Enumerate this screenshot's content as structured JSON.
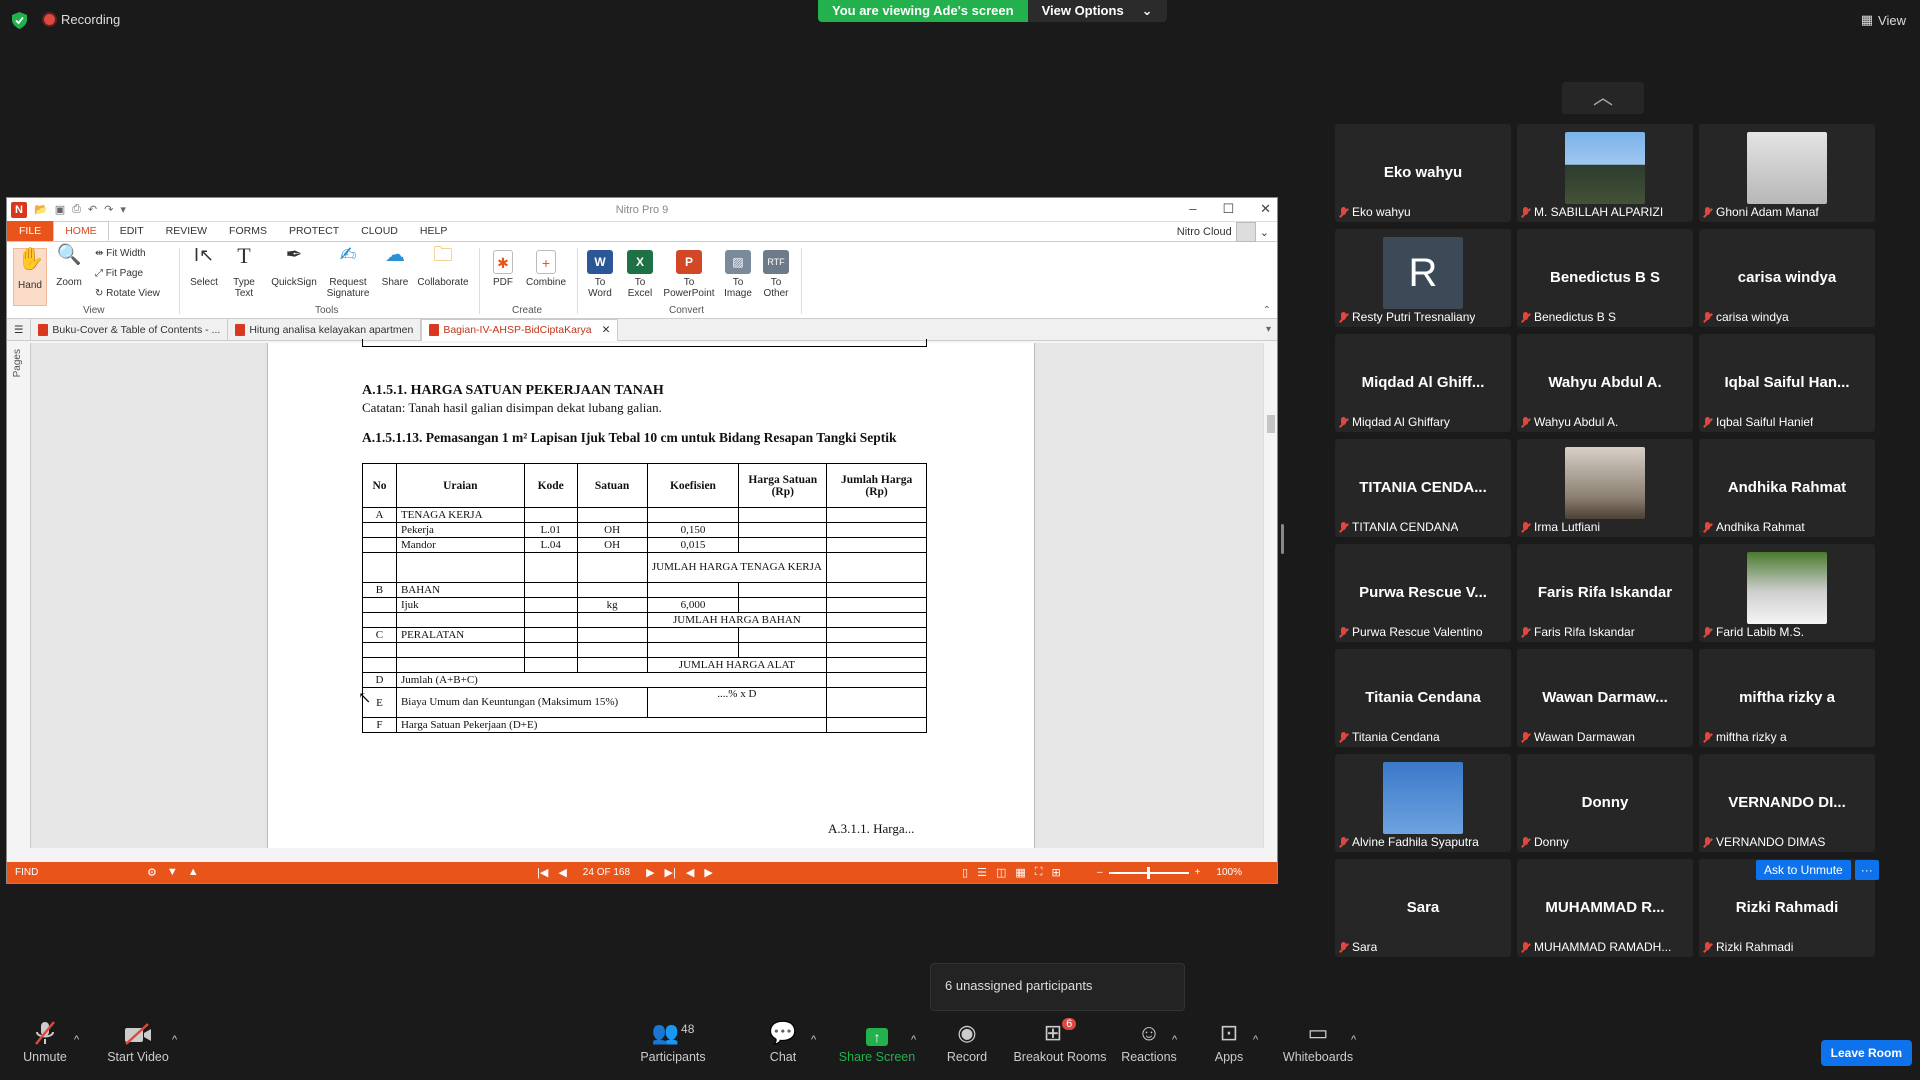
{
  "topbar": {
    "recording": "Recording",
    "viewing": "You are viewing Ade's screen",
    "view_options": "View Options",
    "view": "View"
  },
  "nitro": {
    "app_title": "Nitro Pro 9",
    "menu": {
      "file": "FILE",
      "tabs": [
        "HOME",
        "EDIT",
        "REVIEW",
        "FORMS",
        "PROTECT",
        "CLOUD",
        "HELP"
      ]
    },
    "cloud": "Nitro Cloud",
    "ribbon": {
      "hand": "Hand",
      "zoom": "Zoom",
      "fit_width": "Fit Width",
      "fit_page": "Fit Page",
      "rotate_view": "Rotate View",
      "view_group": "View",
      "select": "Select",
      "type_text_1": "Type",
      "type_text_2": "Text",
      "quicksign": "QuickSign",
      "request_sig_1": "Request",
      "request_sig_2": "Signature",
      "share": "Share",
      "collaborate": "Collaborate",
      "tools_group": "Tools",
      "pdf": "PDF",
      "combine": "Combine",
      "create_group": "Create",
      "to_word_1": "To",
      "to_word_2": "Word",
      "to_excel_1": "To",
      "to_excel_2": "Excel",
      "to_ppt_1": "To",
      "to_ppt_2": "PowerPoint",
      "to_image_1": "To",
      "to_image_2": "Image",
      "to_other_1": "To",
      "to_other_2": "Other",
      "convert_group": "Convert"
    },
    "doctabs": [
      "Buku-Cover & Table of Contents - ...",
      "Hitung analisa kelayakan apartmen",
      "Bagian-IV-AHSP-BidCiptaKarya"
    ],
    "pages_panel": "Pages",
    "doc": {
      "heading1": "A.1.5.1.  HARGA SATUAN PEKERJAAN TANAH",
      "note": "Catatan: Tanah hasil galian disimpan dekat lubang galian.",
      "heading2": "A.1.5.1.13. Pemasangan 1 m² Lapisan Ijuk Tebal 10 cm untuk Bidang Resapan Tangki Septik",
      "headers": [
        "No",
        "Uraian",
        "Kode",
        "Satuan",
        "Koefisien",
        "Harga Satuan (Rp)",
        "Jumlah Harga (Rp)"
      ],
      "rows": {
        "a_no": "A",
        "a_label": "TENAGA KERJA",
        "pekerja": "Pekerja",
        "pekerja_kode": "L.01",
        "pekerja_sat": "OH",
        "pekerja_koef": "0,150",
        "mandor": "Mandor",
        "mandor_kode": "L.04",
        "mandor_sat": "OH",
        "mandor_koef": "0,015",
        "jumlah_tk": "JUMLAH HARGA TENAGA KERJA",
        "b_no": "B",
        "b_label": "BAHAN",
        "ijuk": "Ijuk",
        "ijuk_sat": "kg",
        "ijuk_koef": "6,000",
        "jumlah_bahan": "JUMLAH HARGA BAHAN",
        "c_no": "C",
        "c_label": "PERALATAN",
        "jumlah_alat": "JUMLAH HARGA ALAT",
        "d_no": "D",
        "d_label": "Jumlah (A+B+C)",
        "e_no": "E",
        "e_label": "Biaya Umum dan Keuntungan (Maksimum 15%)",
        "e_val": "....% x D",
        "f_no": "F",
        "f_label": "Harga Satuan Pekerjaan (D+E)"
      },
      "footer": "A.3.1.1. Harga..."
    },
    "status": {
      "find": "FIND",
      "page": "24 OF 168",
      "zoom": "100%"
    }
  },
  "participants": [
    {
      "display": "Eko wahyu",
      "label": "Eko wahyu"
    },
    {
      "display": "",
      "label": "M. SABILLAH ALPARIZI"
    },
    {
      "display": "",
      "label": "Ghoni Adam Manaf"
    },
    {
      "display": "R",
      "label": "Resty Putri Tresnaliany"
    },
    {
      "display": "Benedictus B S",
      "label": "Benedictus B S"
    },
    {
      "display": "carisa windya",
      "label": "carisa windya"
    },
    {
      "display": "Miqdad Al Ghiff...",
      "label": "Miqdad Al Ghiffary"
    },
    {
      "display": "Wahyu Abdul A.",
      "label": "Wahyu Abdul A."
    },
    {
      "display": "Iqbal Saiful Han...",
      "label": "Iqbal Saiful Hanief"
    },
    {
      "display": "TITANIA CENDA...",
      "label": "TITANIA CENDANA"
    },
    {
      "display": "",
      "label": "Irma Lutfiani"
    },
    {
      "display": "Andhika Rahmat",
      "label": "Andhika Rahmat"
    },
    {
      "display": "Purwa Rescue V...",
      "label": "Purwa Rescue Valentino"
    },
    {
      "display": "Faris Rifa Iskandar",
      "label": "Faris Rifa Iskandar"
    },
    {
      "display": "",
      "label": "Farid Labib M.S."
    },
    {
      "display": "Titania Cendana",
      "label": "Titania Cendana"
    },
    {
      "display": "Wawan  Darmaw...",
      "label": "Wawan Darmawan"
    },
    {
      "display": "miftha rizky a",
      "label": "miftha rizky a"
    },
    {
      "display": "",
      "label": "Alvine Fadhila Syaputra"
    },
    {
      "display": "Donny",
      "label": "Donny"
    },
    {
      "display": "VERNANDO DI...",
      "label": "VERNANDO DIMAS"
    },
    {
      "display": "Sara",
      "label": "Sara"
    },
    {
      "display": "MUHAMMAD  R...",
      "label": "MUHAMMAD RAMADH..."
    },
    {
      "display": "Rizki Rahmadi",
      "label": "Rizki Rahmadi"
    }
  ],
  "ask_unmute": "Ask to Unmute",
  "unassigned": "6 unassigned participants",
  "toolbar": {
    "unmute": "Unmute",
    "start_video": "Start Video",
    "participants": "Participants",
    "participants_count": "48",
    "chat": "Chat",
    "share_screen": "Share Screen",
    "record": "Record",
    "breakout": "Breakout Rooms",
    "breakout_badge": "6",
    "reactions": "Reactions",
    "apps": "Apps",
    "whiteboards": "Whiteboards",
    "leave": "Leave Room"
  },
  "colors": {
    "zoom_green": "#22b14c",
    "nitro_orange": "#e8541a",
    "zoom_blue": "#0e72ed",
    "mute_red": "#e0473d"
  }
}
